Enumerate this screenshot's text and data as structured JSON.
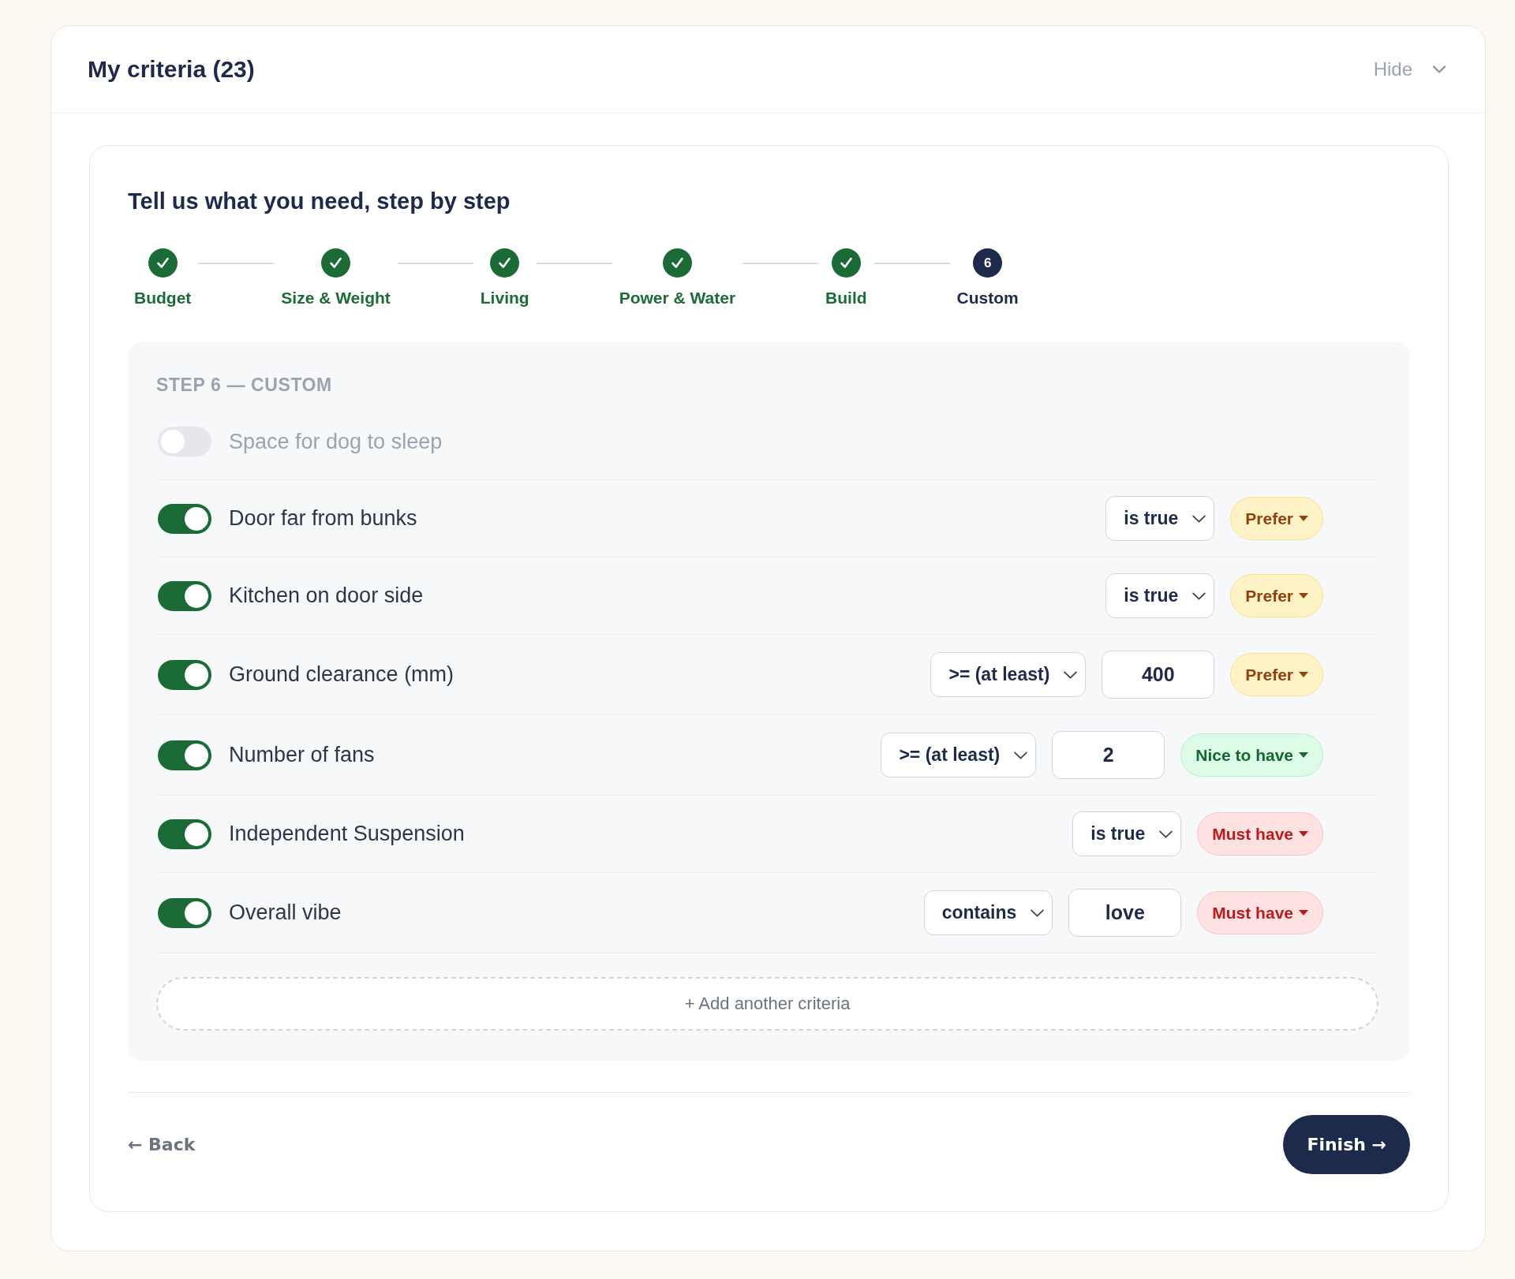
{
  "panel": {
    "title": "My criteria (23)",
    "hide_button": "Hide"
  },
  "wizard": {
    "title": "Tell us what you need, step by step",
    "steps": [
      {
        "label": "Budget",
        "completed": true,
        "selected": false
      },
      {
        "label": "Size & Weight",
        "completed": true,
        "selected": false
      },
      {
        "label": "Living",
        "completed": true,
        "selected": false
      },
      {
        "label": "Power & Water",
        "completed": true,
        "selected": false
      },
      {
        "label": "Build",
        "completed": true,
        "selected": false
      },
      {
        "label": "Custom",
        "number": "6",
        "completed": false,
        "selected": true
      }
    ],
    "section": {
      "heading": "STEP 6 — CUSTOM",
      "criteria": [
        {
          "label": "Space for dog to sleep",
          "on": false
        },
        {
          "label": "Door far from bunks",
          "on": true,
          "operator": "is true",
          "priority": {
            "label": "Prefer",
            "kind": "prefer"
          }
        },
        {
          "label": "Kitchen on door side",
          "on": true,
          "operator": "is true",
          "priority": {
            "label": "Prefer",
            "kind": "prefer"
          }
        },
        {
          "label": "Ground clearance (mm)",
          "on": true,
          "operator": ">= (at least)",
          "value": "400",
          "priority": {
            "label": "Prefer",
            "kind": "prefer"
          }
        },
        {
          "label": "Number of fans",
          "on": true,
          "operator": ">= (at least)",
          "value": "2",
          "priority": {
            "label": "Nice to have",
            "kind": "nice"
          }
        },
        {
          "label": "Independent Suspension",
          "on": true,
          "operator": "is true",
          "priority": {
            "label": "Must have",
            "kind": "must"
          }
        },
        {
          "label": "Overall vibe",
          "on": true,
          "operator": "contains",
          "value": "love",
          "priority": {
            "label": "Must have",
            "kind": "must"
          }
        }
      ],
      "add_button": "+ Add another criteria"
    },
    "back_link": "← Back",
    "finish_button": "Finish →"
  }
}
